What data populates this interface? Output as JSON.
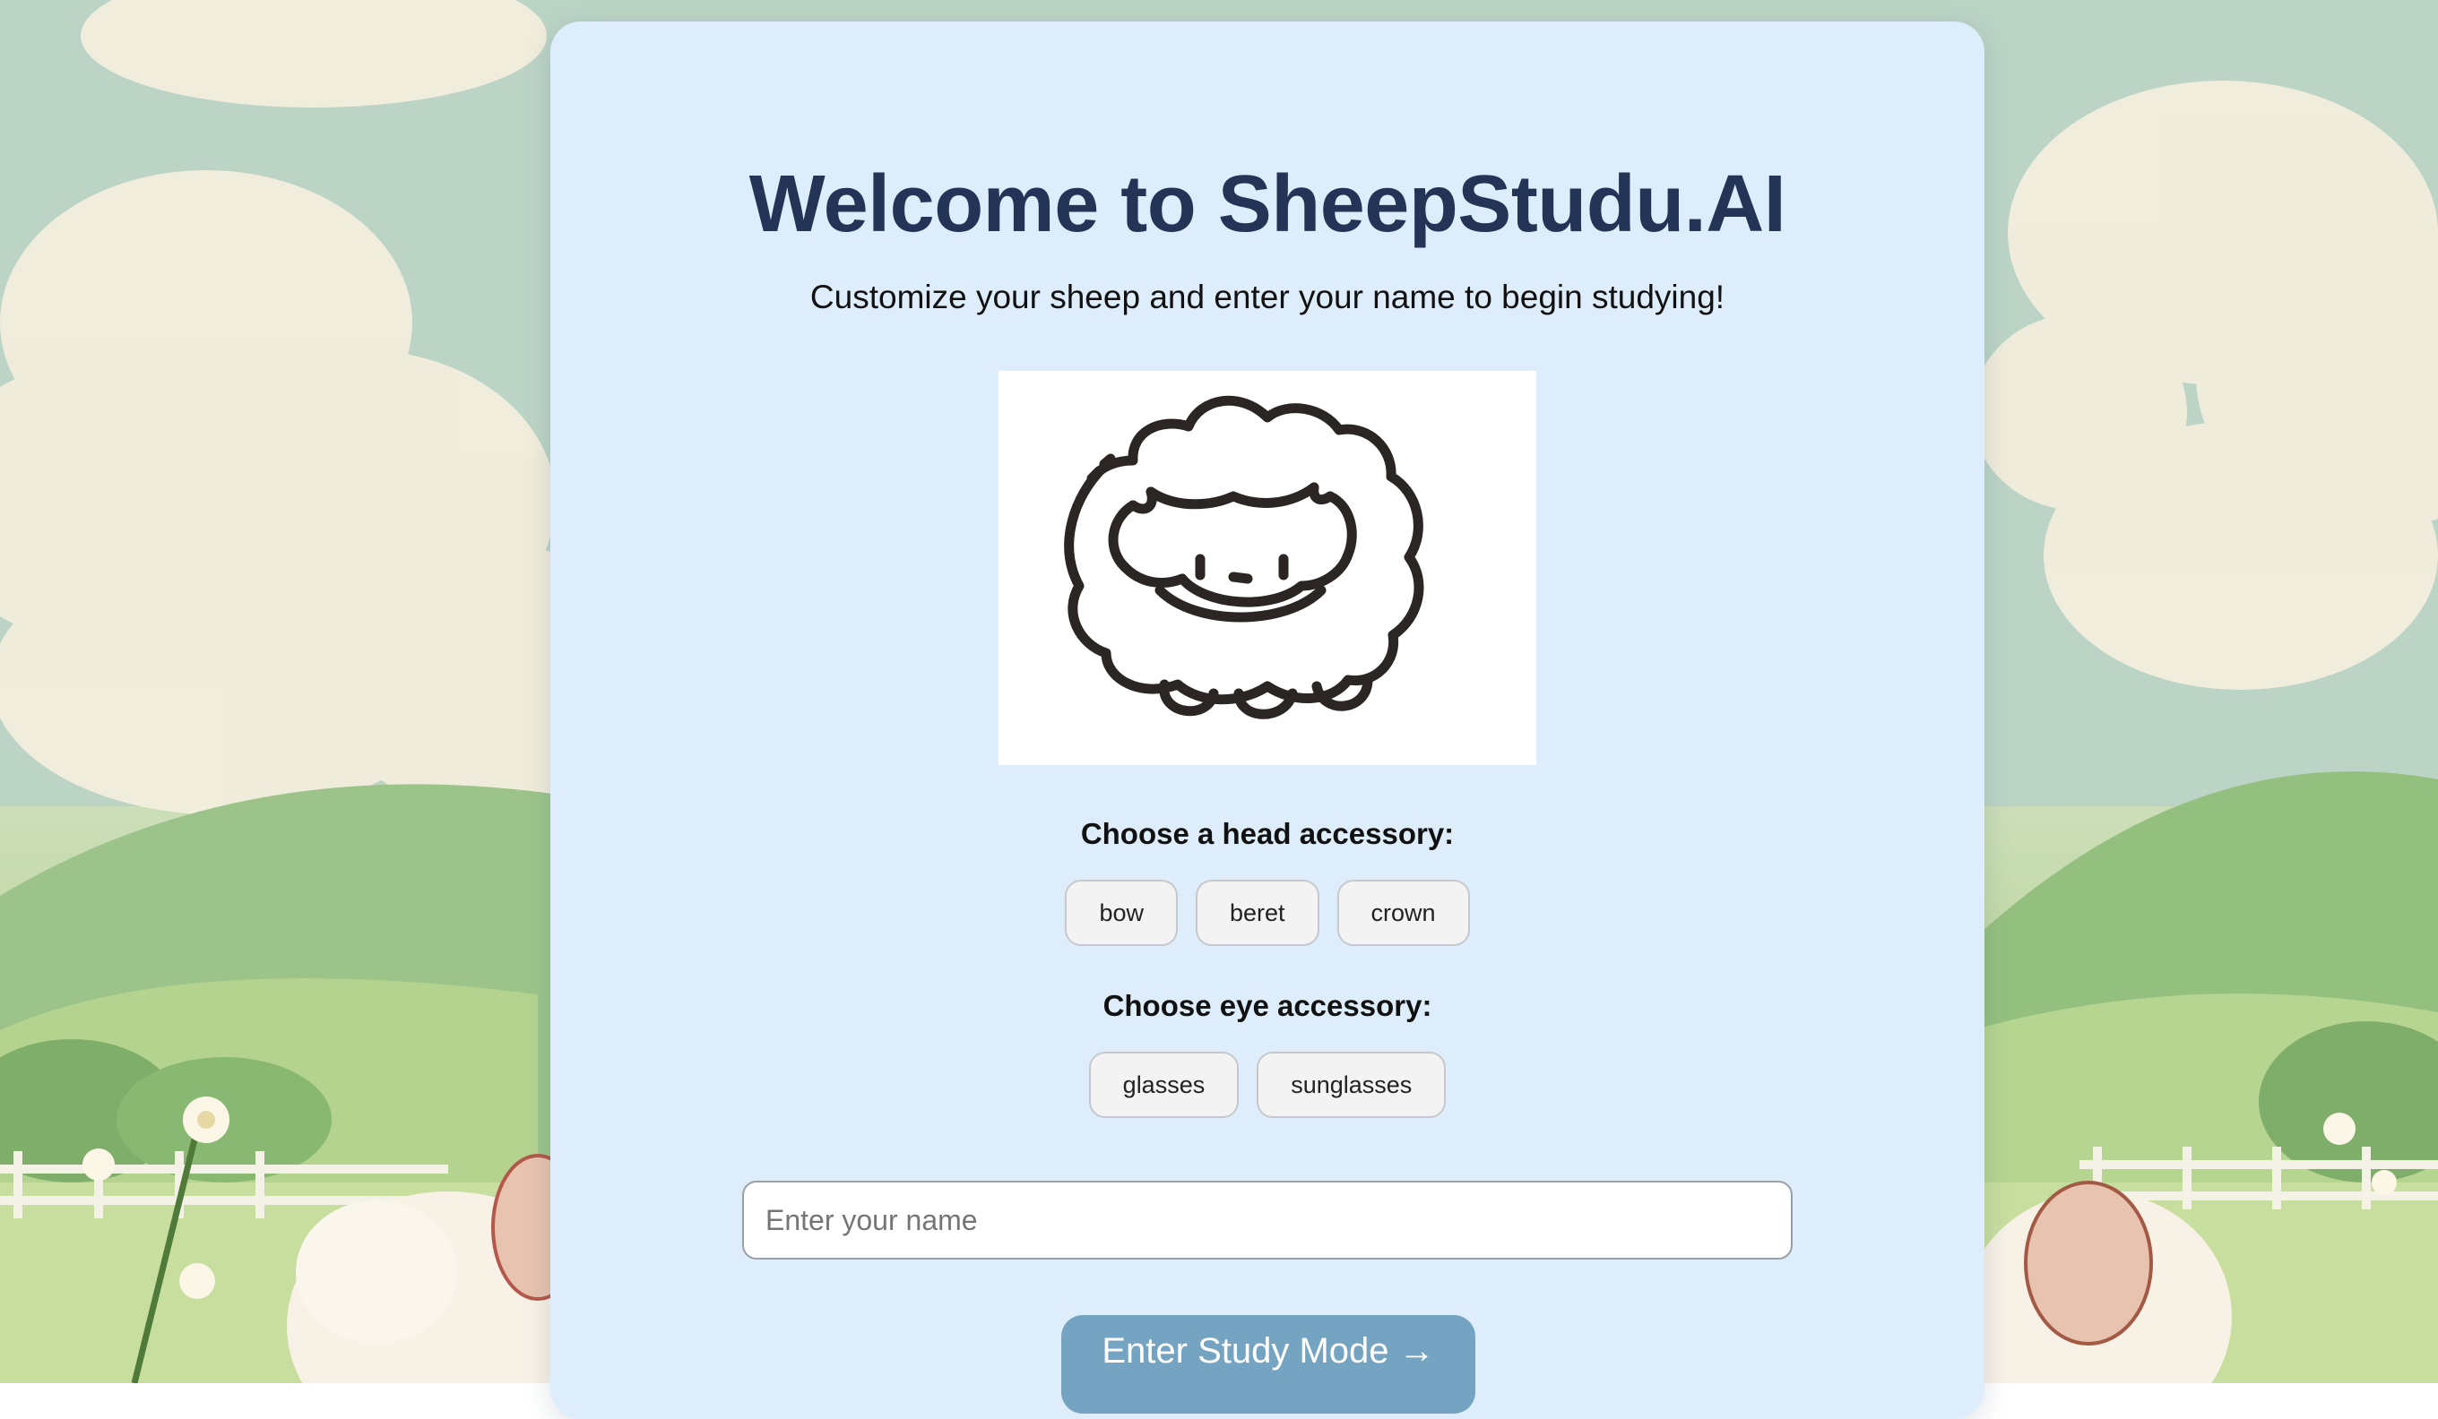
{
  "header": {
    "title": "Welcome to SheepStudu.AI",
    "subtitle": "Customize your sheep and enter your name to begin studying!"
  },
  "preview": {
    "icon": "sheep-drawing"
  },
  "head_accessory": {
    "label": "Choose a head accessory:",
    "options": [
      "bow",
      "beret",
      "crown"
    ]
  },
  "eye_accessory": {
    "label": "Choose eye accessory:",
    "options": [
      "glasses",
      "sunglasses"
    ]
  },
  "name_input": {
    "placeholder": "Enter your name",
    "value": ""
  },
  "enter_button": {
    "label": "Enter Study Mode →"
  },
  "colors": {
    "card": "#deedfb",
    "title": "#233456",
    "primary_button": "#74a4c2"
  }
}
